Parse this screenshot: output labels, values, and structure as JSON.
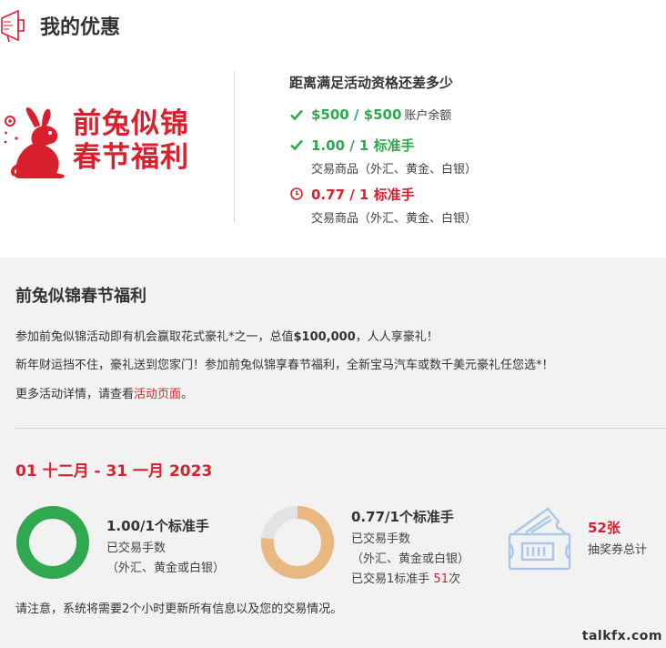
{
  "header": {
    "title": "我的优惠",
    "icon": "megaphone-icon"
  },
  "promo": {
    "brand_line1": "前兔似锦",
    "brand_line2": "春节福利"
  },
  "requirements": {
    "title": "距离满足活动资格还差多少",
    "items": [
      {
        "status": "done",
        "main": "$500 / $500",
        "tail": "账户余额",
        "sub": ""
      },
      {
        "status": "done",
        "main": "1.00 / 1 标准手",
        "tail": "",
        "sub": "交易商品（外汇、黄金、白银）"
      },
      {
        "status": "pending",
        "main": "0.77 / 1 标准手",
        "tail": "",
        "sub": "交易商品（外汇、黄金、白银）"
      }
    ]
  },
  "panel": {
    "title": "前兔似锦春节福利",
    "para1_pre": "参加前兔似锦活动即有机会赢取花式豪礼*之一，总值",
    "para1_bold": "$100,000",
    "para1_post": "，人人享豪礼！",
    "para2": "新年财运挡不住，豪礼送到您家门！参加前兔似锦享春节福利，全新宝马汽车或数千美元豪礼任您选*！",
    "para3_pre": "更多活动详情，请查看",
    "para3_link": "活动页面",
    "para3_post": "。",
    "date_range": "01 十二月 - 31 一月 2023",
    "stats": [
      {
        "progress": 1.0,
        "title": "1.00/1个标准手",
        "line2": "已交易手数",
        "line3": "（外汇、黄金或白银）"
      },
      {
        "progress": 0.77,
        "title": "0.77/1个标准手",
        "line2": "已交易手数",
        "line3": "（外汇、黄金或白银）",
        "line4_pre": "已交易1标准手",
        "line4_num": "51",
        "line4_post": "次"
      }
    ],
    "tickets": {
      "count": "52张",
      "label": "抽奖券总计",
      "icon": "ticket-icon"
    },
    "notice": "请注意，系统将需要2个小时更新所有信息以及您的交易情况。"
  },
  "watermark": "talkfx.com",
  "colors": {
    "accent_red": "#d9202e",
    "success_green": "#2fa84f",
    "ring_orange": "#e8b880",
    "ring_track": "#e3e3e3",
    "ticket_blue": "#a9c7e8"
  }
}
